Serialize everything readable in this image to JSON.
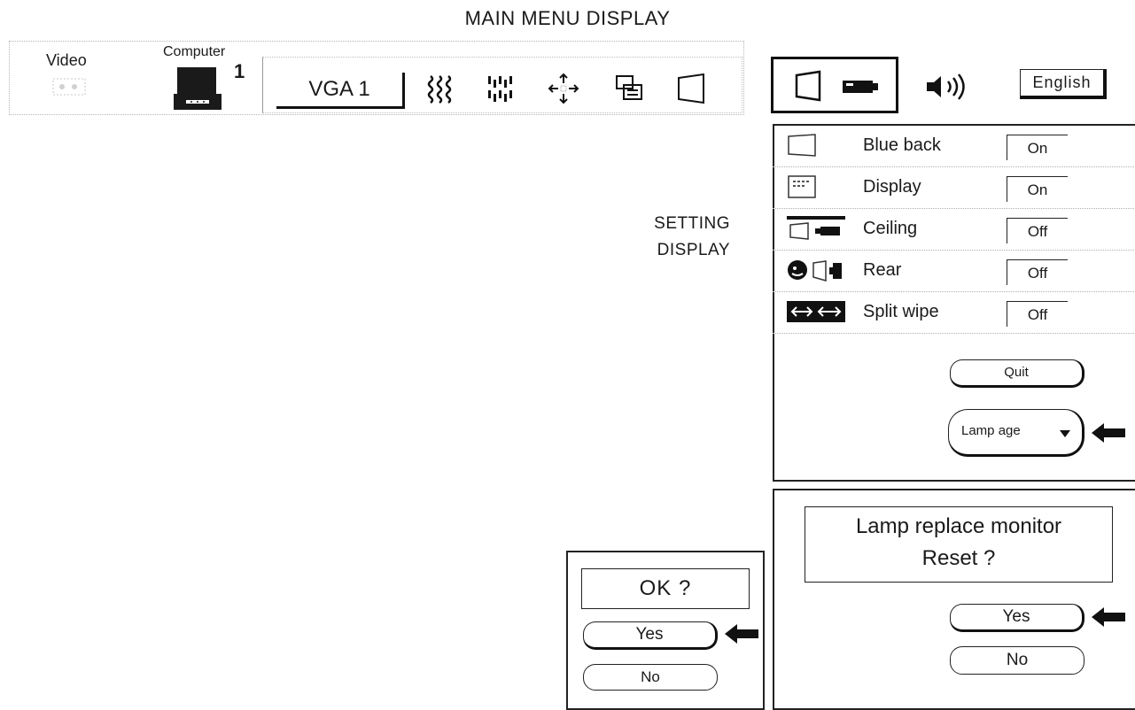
{
  "title": "MAIN MENU DISPLAY",
  "menubar": {
    "video_label": "Video",
    "computer_label": "Computer",
    "computer_number": "1",
    "source_name": "VGA 1",
    "toolbar_icons": [
      "wave-adjust-icon",
      "frame-adjust-icon",
      "position-adjust-icon",
      "picture-adjust-icon",
      "screen-adjust-icon"
    ]
  },
  "right_tabs": {
    "icons": [
      "setting-screen-icon",
      "projector-icon",
      "speaker-icon"
    ],
    "language_label": "English"
  },
  "setting_label": [
    "SETTING",
    "DISPLAY"
  ],
  "settings": [
    {
      "label": "Blue back",
      "value": "On",
      "icon": "blue-back-icon"
    },
    {
      "label": "Display",
      "value": "On",
      "icon": "display-icon"
    },
    {
      "label": "Ceiling",
      "value": "Off",
      "icon": "ceiling-icon"
    },
    {
      "label": "Rear",
      "value": "Off",
      "icon": "rear-icon"
    },
    {
      "label": "Split wipe",
      "value": "Off",
      "icon": "split-wipe-icon"
    }
  ],
  "buttons": {
    "quit": "Quit",
    "lamp_age": "Lamp age"
  },
  "lamp_dialog": {
    "line1": "Lamp replace monitor",
    "line2": "Reset ?",
    "yes": "Yes",
    "no": "No"
  },
  "ok_dialog": {
    "text": "OK ?",
    "yes": "Yes",
    "no": "No"
  }
}
